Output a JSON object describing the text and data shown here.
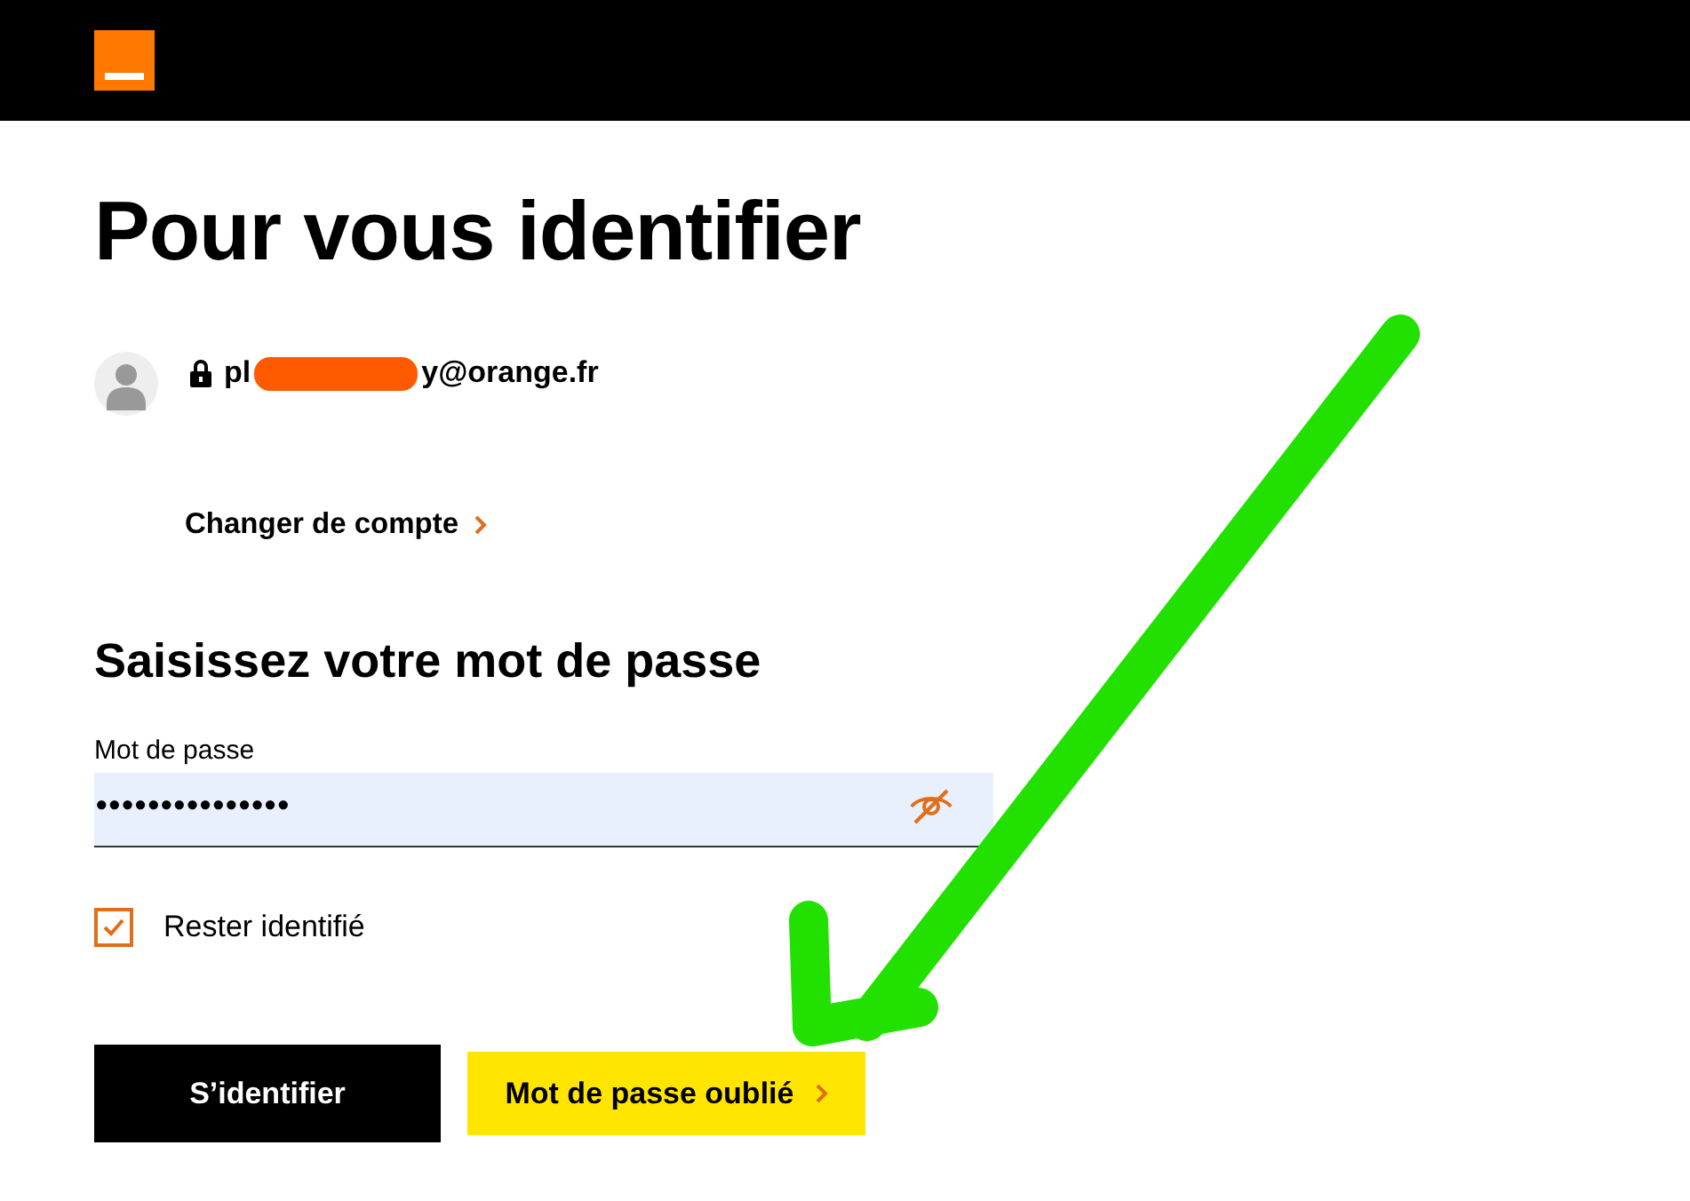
{
  "title": "Pour vous identifier",
  "account": {
    "email_start": "pl",
    "email_end": "y@orange.fr",
    "redacted": true,
    "switch_link": "Changer de compte"
  },
  "password_section": {
    "heading": "Saisissez votre mot de passe",
    "label": "Mot de passe",
    "value": "•••••••••••••••",
    "show_password": false
  },
  "remember": {
    "label": "Rester identifié",
    "checked": true
  },
  "buttons": [
    {
      "label": "S’identifier",
      "kind": "primary"
    },
    {
      "label": "Mot de passe oublié",
      "kind": "highlight"
    }
  ],
  "annotation": {
    "kind": "arrow"
  }
}
